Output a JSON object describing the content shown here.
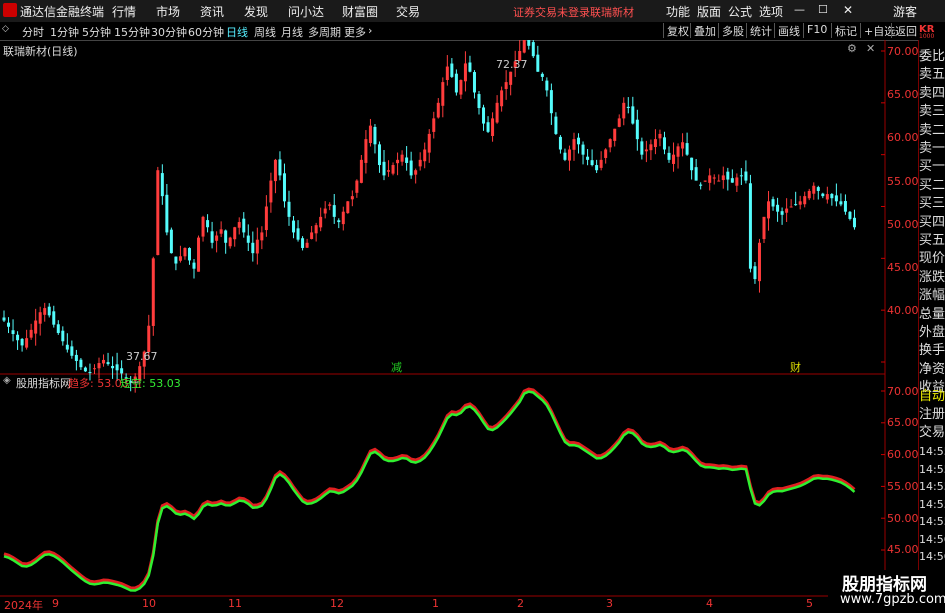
{
  "titlebar": {
    "app_name": "通达信金融终端",
    "menus": [
      "行情",
      "市场",
      "资讯",
      "发现",
      "问小达",
      "财富圈",
      "交易"
    ],
    "notice": "证券交易未登录",
    "stock": "联瑞新材",
    "right_menus": [
      "功能",
      "版面",
      "公式",
      "选项"
    ],
    "guest": "游客"
  },
  "timebar": {
    "periods": [
      "分时",
      "1分钟",
      "5分钟",
      "15分钟",
      "30分钟",
      "60分钟",
      "日线",
      "周线",
      "月线",
      "多周期",
      "更多"
    ],
    "active": "日线",
    "right_buttons": [
      "复权",
      "叠加",
      "多股",
      "统计",
      "画线",
      "F10",
      "标记",
      "+自选",
      "返回"
    ]
  },
  "main_chart": {
    "title": "联瑞新材(日线)",
    "high_label": "72.37",
    "low_label": "37.67",
    "event_labels": [
      "减",
      "财"
    ],
    "y_ticks": [
      "70.00",
      "65.00",
      "60.00",
      "55.00",
      "50.00",
      "45.00",
      "40.00"
    ]
  },
  "indicator": {
    "name": "股朋指标网",
    "line1_label": "趋多: 53.03",
    "line2_label": "短空: 53.03",
    "y_ticks": [
      "70.00",
      "65.00",
      "60.00",
      "55.00",
      "50.00",
      "45.00"
    ]
  },
  "right_panel": {
    "top": "KR",
    "sub": "1000",
    "items": [
      "委比",
      "卖五",
      "卖四",
      "卖三",
      "卖二",
      "卖一",
      "买一",
      "买二",
      "买三",
      "买四",
      "买五",
      "现价",
      "涨跌",
      "涨幅",
      "总量",
      "外盘",
      "换手",
      "净资",
      "收益"
    ],
    "items2": [
      "自动",
      "注册",
      "交易"
    ],
    "times": [
      "14:55",
      "14:55",
      "14:55",
      "14:55",
      "14:55",
      "14:56",
      "14:56"
    ]
  },
  "date_axis": [
    "2024年",
    "9",
    "10",
    "11",
    "12",
    "1",
    "2",
    "3",
    "4",
    "5"
  ],
  "watermark": {
    "title": "股朋指标网",
    "url": "www.7gpzb.com"
  },
  "chart_data": {
    "type": "candlestick",
    "title": "联瑞新材(日线)",
    "ylim": [
      37,
      73
    ],
    "closes": [
      44.0,
      43.4,
      42.7,
      42.1,
      41.6,
      42.3,
      43.1,
      44.0,
      44.8,
      45.2,
      44.5,
      43.6,
      42.8,
      42.0,
      41.2,
      40.6,
      40.1,
      39.5,
      39.1,
      39.0,
      39.4,
      39.9,
      40.2,
      39.8,
      39.4,
      39.2,
      38.9,
      38.4,
      38.0,
      38.6,
      39.6,
      41.0,
      43.5,
      50.0,
      58.5,
      56.0,
      52.5,
      50.5,
      49.5,
      50.2,
      51.0,
      49.8,
      49.0,
      52.0,
      54.0,
      53.0,
      51.5,
      52.2,
      52.8,
      51.5,
      52.0,
      53.0,
      53.5,
      52.5,
      51.5,
      50.5,
      51.8,
      52.5,
      55.0,
      57.5,
      59.5,
      58.0,
      55.5,
      54.0,
      52.5,
      51.8,
      51.0,
      51.5,
      52.5,
      53.2,
      54.0,
      54.8,
      55.2,
      54.0,
      53.5,
      54.5,
      55.5,
      56.0,
      57.5,
      59.5,
      61.5,
      62.8,
      61.0,
      59.0,
      58.0,
      58.5,
      59.0,
      59.5,
      60.0,
      59.2,
      58.0,
      58.5,
      59.5,
      60.5,
      62.0,
      63.5,
      65.0,
      67.0,
      68.5,
      67.5,
      66.0,
      67.2,
      68.8,
      68.0,
      66.0,
      64.5,
      63.0,
      62.2,
      63.5,
      65.0,
      66.2,
      67.0,
      68.0,
      69.0,
      70.0,
      72.0,
      70.5,
      69.5,
      68.0,
      67.5,
      66.2,
      64.0,
      62.0,
      60.5,
      59.5,
      60.5,
      61.5,
      61.0,
      60.0,
      59.5,
      59.0,
      58.5,
      59.5,
      60.5,
      61.5,
      62.5,
      63.5,
      65.0,
      64.5,
      63.0,
      61.5,
      60.0,
      60.5,
      61.0,
      61.5,
      62.0,
      60.5,
      59.5,
      60.0,
      60.8,
      61.2,
      60.0,
      58.5,
      57.5,
      57.0,
      57.5,
      58.0,
      57.8,
      57.5,
      58.0,
      57.6,
      57.3,
      57.8,
      58.0,
      57.5,
      49.0,
      48.0,
      51.5,
      54.0,
      55.5,
      55.0,
      54.5,
      54.2,
      54.8,
      55.0,
      55.2,
      55.5,
      56.0,
      56.5,
      57.0,
      56.5,
      56.0,
      56.2,
      55.8,
      55.5,
      55.2,
      54.5,
      53.8,
      53.0
    ]
  }
}
